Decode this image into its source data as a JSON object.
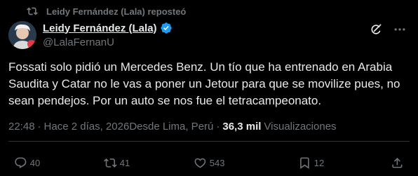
{
  "repost": {
    "text": "Leidy Fernández (Lala) reposteó",
    "icon": "repost-icon"
  },
  "author": {
    "display_name": "Leidy Fernández (Lala)",
    "handle": "@LalaFernanU",
    "verified_icon": "verified-badge-icon",
    "verified_color": "#1d9bf0"
  },
  "tweet": {
    "text": "Fossati solo pidió un Mercedes Benz. Un tío que ha entrenado en Arabia Saudita y Catar no le vas a poner un Jetour para que se movilize pues, no sean pendejos. Por un auto se nos fue el tetracampeonato."
  },
  "meta": {
    "time": "22:48",
    "separator": "·",
    "date": "Hace 2 días, 2026",
    "location": "Desde Lima, Perú",
    "views_count": "36,3 mil",
    "views_label": "Visualizaciones"
  },
  "actions": {
    "replies": "40",
    "reposts": "41",
    "likes": "543",
    "bookmarks": "12"
  },
  "colors": {
    "background": "#000000",
    "text_primary": "#e7e9ea",
    "text_secondary": "#71767b",
    "divider": "#2f3336",
    "accent": "#1d9bf0"
  }
}
